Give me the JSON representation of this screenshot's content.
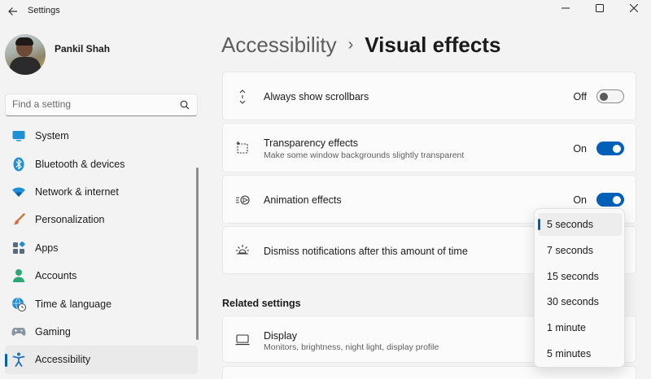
{
  "window": {
    "title": "Settings"
  },
  "profile": {
    "name": "Pankil Shah"
  },
  "search": {
    "placeholder": "Find a setting"
  },
  "sidebar": {
    "items": [
      {
        "label": "System",
        "icon": "system-icon"
      },
      {
        "label": "Bluetooth & devices",
        "icon": "bluetooth-icon"
      },
      {
        "label": "Network & internet",
        "icon": "wifi-icon"
      },
      {
        "label": "Personalization",
        "icon": "brush-icon"
      },
      {
        "label": "Apps",
        "icon": "apps-icon"
      },
      {
        "label": "Accounts",
        "icon": "accounts-icon"
      },
      {
        "label": "Time & language",
        "icon": "globe-clock-icon"
      },
      {
        "label": "Gaming",
        "icon": "gamepad-icon"
      },
      {
        "label": "Accessibility",
        "icon": "accessibility-icon",
        "active": true
      }
    ]
  },
  "breadcrumb": {
    "parent": "Accessibility",
    "separator": "›",
    "current": "Visual effects"
  },
  "settings": {
    "scrollbars": {
      "title": "Always show scrollbars",
      "state_label": "Off",
      "on": false
    },
    "transparency": {
      "title": "Transparency effects",
      "subtitle": "Make some window backgrounds slightly transparent",
      "state_label": "On",
      "on": true
    },
    "animation": {
      "title": "Animation effects",
      "state_label": "On",
      "on": true
    },
    "notifications": {
      "title": "Dismiss notifications after this amount of time"
    }
  },
  "related": {
    "heading": "Related settings",
    "display": {
      "title": "Display",
      "subtitle": "Monitors, brightness, night light, display profile"
    }
  },
  "dropdown": {
    "options": [
      "5 seconds",
      "7 seconds",
      "15 seconds",
      "30 seconds",
      "1 minute",
      "5 minutes"
    ],
    "selected": "5 seconds"
  },
  "colors": {
    "accent": "#005fb8",
    "background": "#f3f3f3",
    "card": "#fbfbfb"
  }
}
